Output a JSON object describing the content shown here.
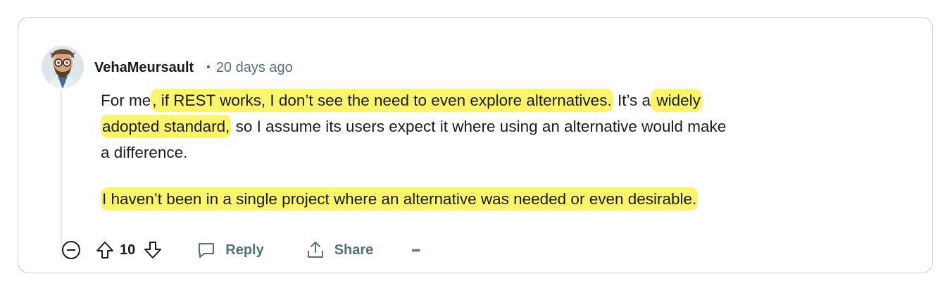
{
  "comment": {
    "author": "VehaMeursault",
    "separator": "•",
    "time": "20 days ago",
    "paragraph1": {
      "p1": "For me",
      "h1": ", if REST works, I don’t see the need to even explore alternatives.",
      "p2": " It’s a",
      "h2a": " widely",
      "h2b": "adopted standard,",
      "p3": " so I assume its users expect it where using an alternative would make",
      "p4": "a difference."
    },
    "paragraph2": "I haven’t been in a single project where an alternative was needed or even desirable.",
    "score": "10"
  },
  "actions": {
    "reply_label": "Reply",
    "share_label": "Share",
    "more_label": "•••"
  },
  "colors": {
    "highlight": "#fbf46d",
    "meta_text": "#576f76",
    "body_text": "#1c1c1c",
    "border": "#c9cdd1"
  },
  "icons": [
    "avatar",
    "collapse-icon",
    "upvote-icon",
    "downvote-icon",
    "reply-icon",
    "share-icon",
    "more-icon"
  ]
}
